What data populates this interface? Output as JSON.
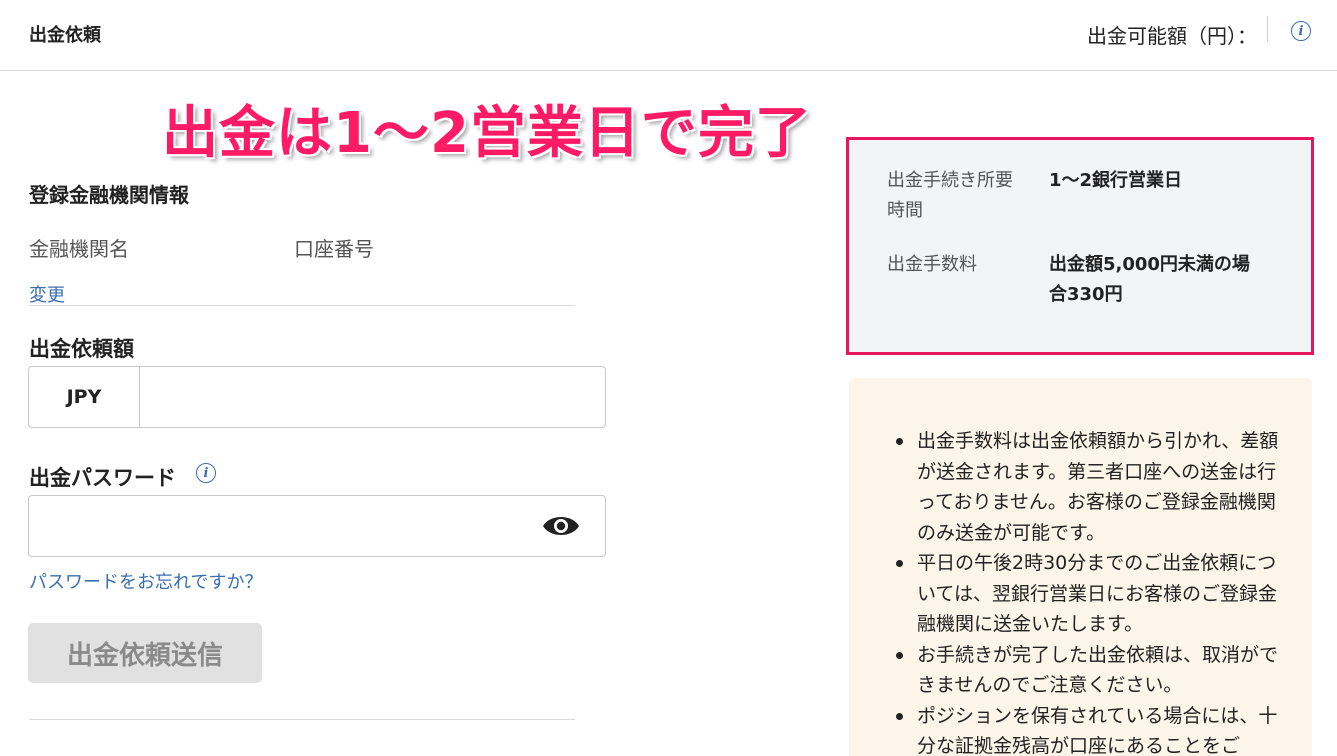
{
  "header": {
    "title": "出金依頼",
    "available_label": "出金可能額（円）："
  },
  "banner": "出金は1～2営業日で完了",
  "bank_info": {
    "title": "登録金融機関情報",
    "bank_name_label": "金融機関名",
    "account_label": "口座番号",
    "change_link": "変更"
  },
  "amount": {
    "title": "出金依頼額",
    "currency": "JPY",
    "value": "",
    "placeholder": ""
  },
  "password": {
    "title": "出金パスワード",
    "value": "",
    "placeholder": "",
    "forgot_link": "パスワードをお忘れですか？"
  },
  "submit_label": "出金依頼送信",
  "info_panel": {
    "time_label_1": "出金手続き所要",
    "time_label_2": "時間",
    "time_value": "1～2銀行営業日",
    "fee_label": "出金手数料",
    "fee_value_1": "出金額5,000円未満の場",
    "fee_value_2": "合330円"
  },
  "notes": [
    "出金手数料は出金依頼額から引かれ、差額が送金されます。第三者口座への送金は行っておりません。お客様のご登録金融機関のみ送金が可能です。",
    "平日の午後2時30分までのご出金依頼については、翌銀行営業日にお客様のご登録金融機関に送金いたします。",
    "お手続きが完了した出金依頼は、取消ができませんのでご注意ください。",
    "ポジションを保有されている場合には、十分な証拠金残高が口座にあることをご"
  ],
  "colors": {
    "accent_blue": "#3a6fb0",
    "highlight_pink": "#e8175d",
    "banner_pink": "#ff1a66",
    "notes_bg": "#fdf5e9"
  }
}
